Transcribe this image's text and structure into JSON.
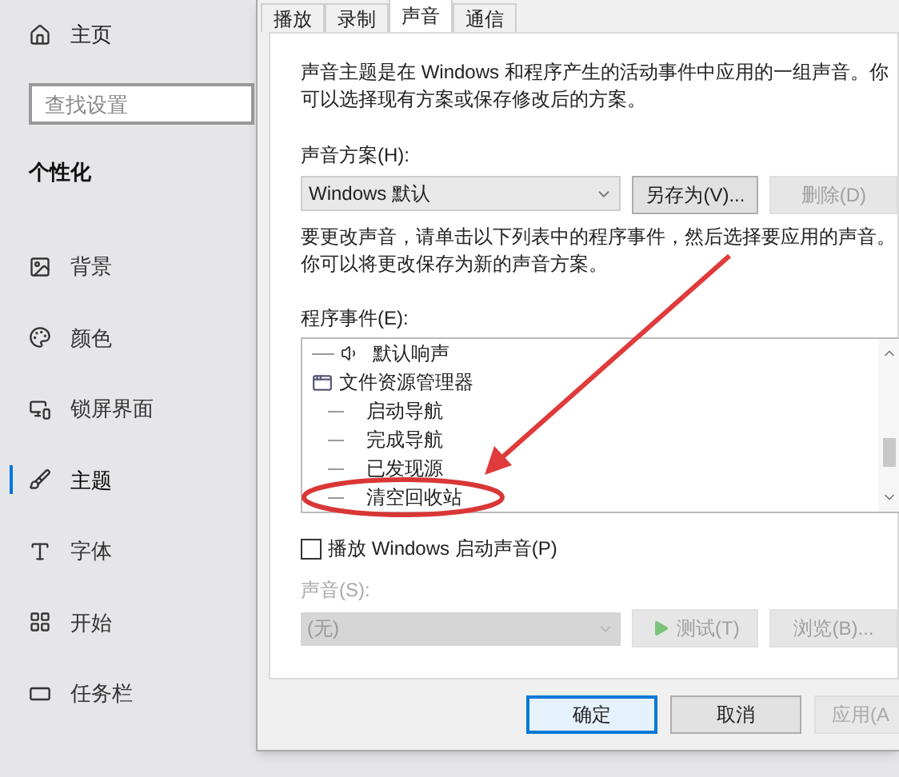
{
  "sidebar": {
    "home": {
      "label": "主页"
    },
    "search": {
      "placeholder": "查找设置"
    },
    "section_title": "个性化",
    "items": [
      {
        "label": "背景",
        "selected": false
      },
      {
        "label": "颜色",
        "selected": false
      },
      {
        "label": "锁屏界面",
        "selected": false
      },
      {
        "label": "主题",
        "selected": true
      },
      {
        "label": "字体",
        "selected": false
      },
      {
        "label": "开始",
        "selected": false
      },
      {
        "label": "任务栏",
        "selected": false
      }
    ]
  },
  "dialog": {
    "tabs": [
      {
        "label": "播放",
        "selected": false
      },
      {
        "label": "录制",
        "selected": false
      },
      {
        "label": "声音",
        "selected": true
      },
      {
        "label": "通信",
        "selected": false
      }
    ],
    "description": "声音主题是在 Windows 和程序产生的活动事件中应用的一组声音。你可以选择现有方案或保存修改后的方案。",
    "scheme": {
      "label": "声音方案(H):",
      "value": "Windows 默认",
      "buttons": [
        {
          "label": "另存为(V)...",
          "disabled": false
        },
        {
          "label": "删除(D)",
          "disabled": true
        }
      ]
    },
    "instruction": "要更改声音，请单击以下列表中的程序事件，然后选择要应用的声音。你可以将更改保存为新的声音方案。",
    "events": {
      "label": "程序事件(E):",
      "items": [
        {
          "label": "默认响声",
          "kind": "sound"
        },
        {
          "label": "文件资源管理器",
          "kind": "group",
          "children": [
            {
              "label": "启动导航",
              "kind": "event"
            },
            {
              "label": "完成导航",
              "kind": "event"
            },
            {
              "label": "已发现源",
              "kind": "event"
            },
            {
              "label": "清空回收站",
              "kind": "event"
            }
          ]
        }
      ]
    },
    "startup_checkbox": {
      "label": "播放 Windows 启动声音(P)",
      "checked": false
    },
    "sound": {
      "label": "声音(S):",
      "value": "(无)",
      "disabled": true,
      "buttons": [
        {
          "label": "测试(T)",
          "kind": "play",
          "disabled": true
        },
        {
          "label": "浏览(B)...",
          "kind": "plain",
          "disabled": true
        }
      ]
    },
    "footer_buttons": [
      {
        "label": "确定",
        "default": true,
        "disabled": false
      },
      {
        "label": "取消",
        "default": false,
        "disabled": false
      },
      {
        "label": "应用(A",
        "default": false,
        "disabled": true
      }
    ]
  }
}
